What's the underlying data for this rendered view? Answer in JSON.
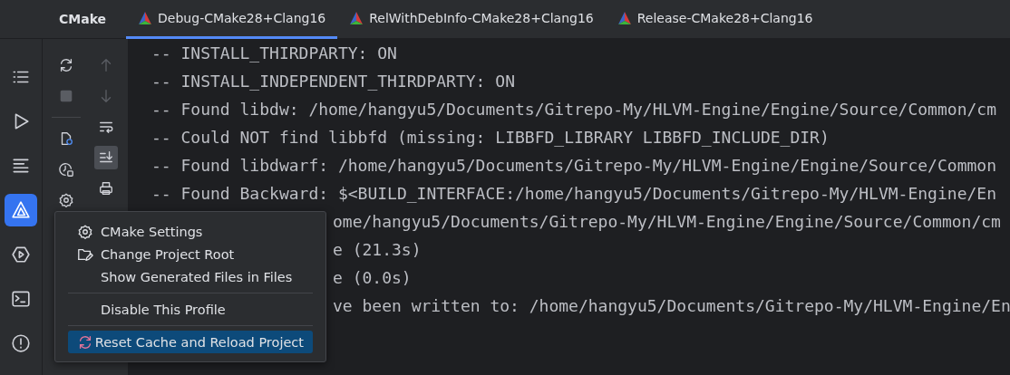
{
  "tool_window": {
    "title": "CMake"
  },
  "tabs": [
    {
      "label": "Debug-CMake28+Clang16",
      "selected": true
    },
    {
      "label": "RelWithDebInfo-CMake28+Clang16",
      "selected": false
    },
    {
      "label": "Release-CMake28+Clang16",
      "selected": false
    }
  ],
  "sidebar": {
    "items": [
      {
        "kind": "list",
        "selected": false
      },
      {
        "kind": "run",
        "selected": false
      },
      {
        "kind": "lines",
        "selected": false
      },
      {
        "kind": "cmake",
        "selected": true
      },
      {
        "kind": "services",
        "selected": false
      },
      {
        "kind": "terminal",
        "selected": false
      },
      {
        "kind": "problems",
        "selected": false
      }
    ]
  },
  "toolbar": [
    {
      "kind": "reload",
      "disabled": false
    },
    {
      "kind": "stop",
      "disabled": true
    },
    {
      "kind": "separator"
    },
    {
      "kind": "cache",
      "disabled": false
    },
    {
      "kind": "history",
      "disabled": false
    },
    {
      "kind": "settings",
      "disabled": false
    }
  ],
  "console_toolbar": [
    {
      "kind": "up",
      "disabled": true,
      "selected": false
    },
    {
      "kind": "down",
      "disabled": true,
      "selected": false
    },
    {
      "kind": "wrap",
      "disabled": false,
      "selected": false
    },
    {
      "kind": "scroll-end",
      "disabled": false,
      "selected": true
    },
    {
      "kind": "print",
      "disabled": false,
      "selected": false
    }
  ],
  "console": {
    "lines": [
      {
        "kind": "full",
        "text": "-- INSTALL_THIRDPARTY: ON"
      },
      {
        "kind": "full",
        "text": "-- INSTALL_INDEPENDENT_THIRDPARTY: ON"
      },
      {
        "kind": "full",
        "text": "-- Found libdw: /home/hangyu5/Documents/Gitrepo-My/HLVM-Engine/Engine/Source/Common/cm"
      },
      {
        "kind": "full",
        "text": "-- Could NOT find libbfd (missing: LIBBFD_LIBRARY LIBBFD_INCLUDE_DIR)"
      },
      {
        "kind": "full",
        "text": "-- Found libdwarf: /home/hangyu5/Documents/Gitrepo-My/HLVM-Engine/Engine/Source/Common"
      },
      {
        "kind": "full",
        "text": "-- Found Backward: $<BUILD_INTERFACE:/home/hangyu5/Documents/Gitrepo-My/HLVM-Engine/En"
      },
      {
        "kind": "partial",
        "text": "ome/hangyu5/Documents/Gitrepo-My/HLVM-Engine/Engine/Source/Common/cm"
      },
      {
        "kind": "partial",
        "text": "e (21.3s)"
      },
      {
        "kind": "partial",
        "text": "e (0.0s)"
      },
      {
        "kind": "partial",
        "text": "ve been written to: /home/hangyu5/Documents/Gitrepo-My/HLVM-Engine/En"
      }
    ]
  },
  "popup_menu": {
    "groups": [
      [
        {
          "label": "CMake Settings",
          "kind": "gear",
          "selected": false
        },
        {
          "label": "Change Project Root",
          "kind": "folder",
          "selected": false
        },
        {
          "label": "Show Generated Files in Files",
          "kind": "plain",
          "selected": false
        }
      ],
      [
        {
          "label": "Disable This Profile",
          "kind": "plain",
          "selected": false
        }
      ],
      [
        {
          "label": "Reset Cache and Reload Project",
          "kind": "reload",
          "selected": true
        }
      ]
    ]
  }
}
